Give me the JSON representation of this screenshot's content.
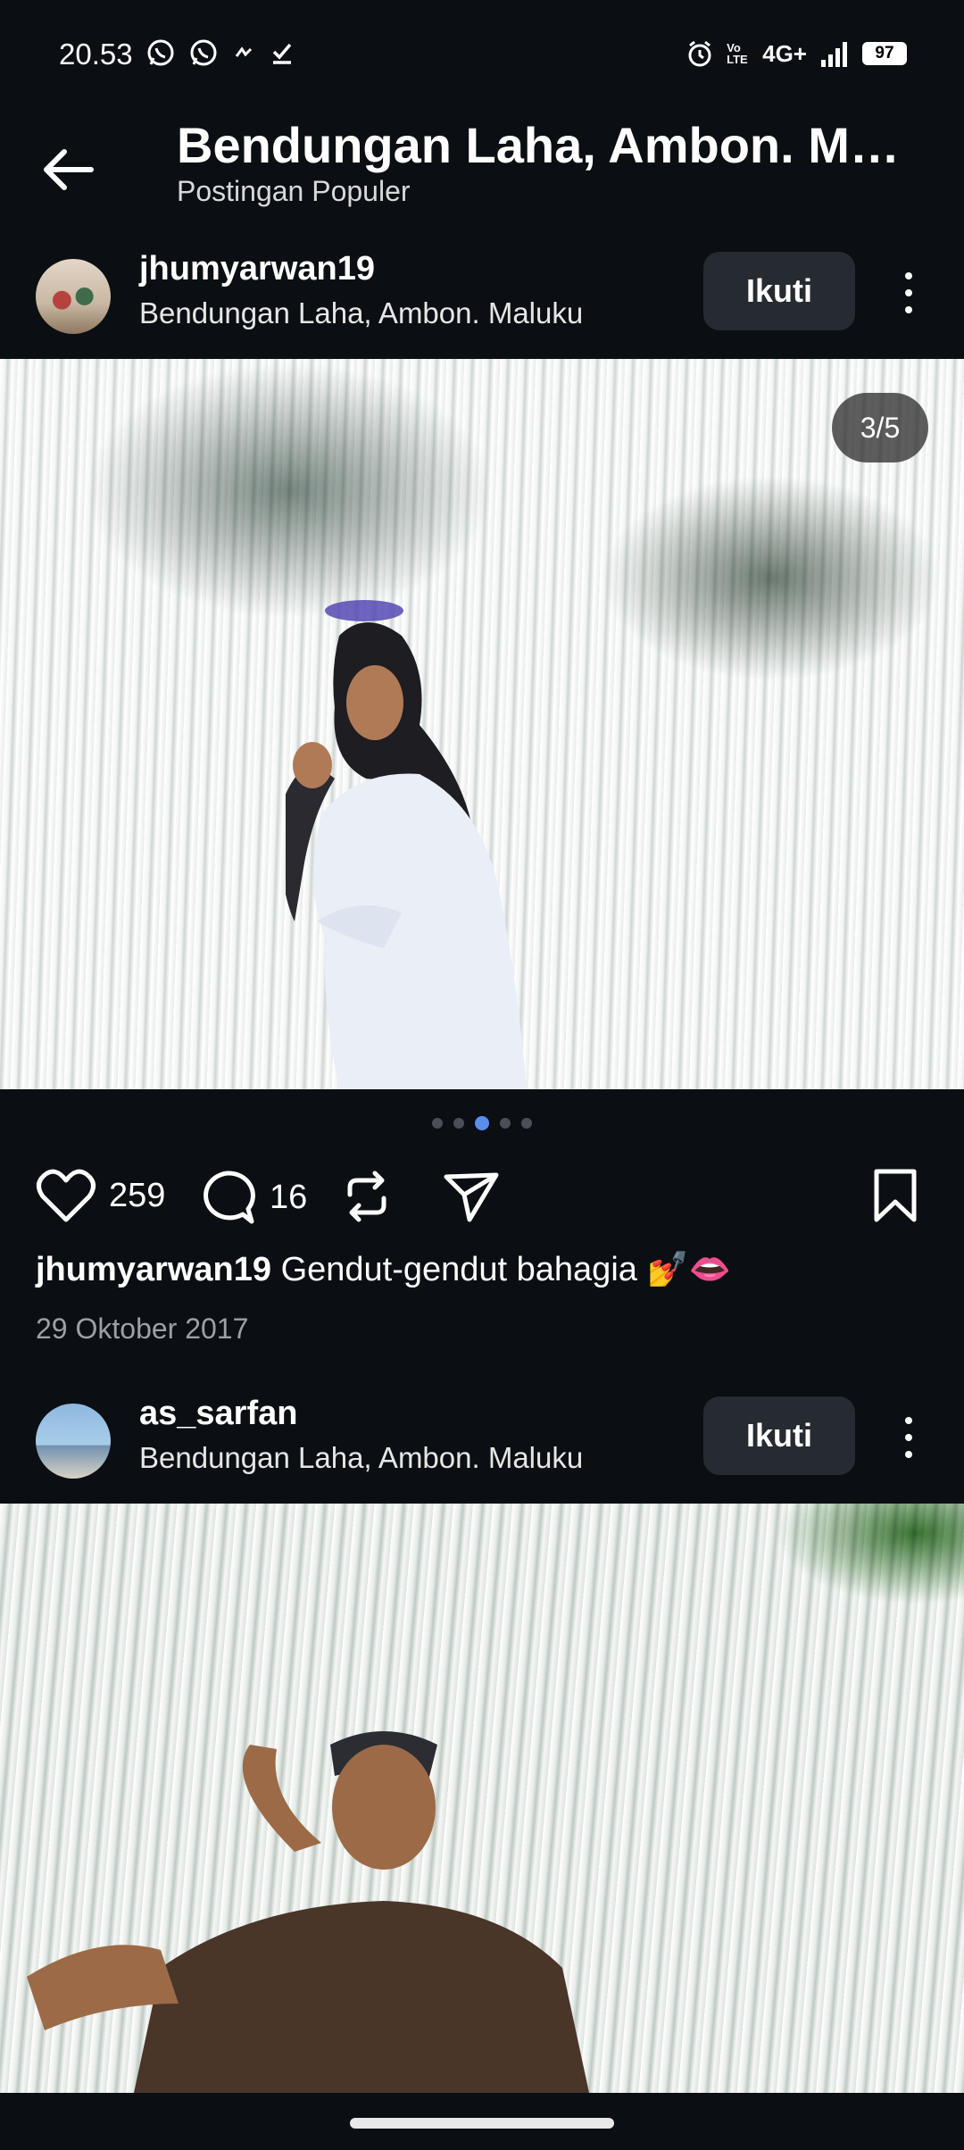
{
  "status_bar": {
    "time": "20.53",
    "network": "4G+",
    "volte": "Vo LTE",
    "battery": "97"
  },
  "header": {
    "title": "Bendungan Laha, Ambon. Mal...",
    "subtitle": "Postingan Populer"
  },
  "posts": [
    {
      "username": "jhumyarwan19",
      "location": "Bendungan Laha, Ambon. Maluku",
      "follow_label": "Ikuti",
      "page_counter": "3/5",
      "carousel": {
        "total": 5,
        "active_index": 2
      },
      "likes": "259",
      "comments": "16",
      "caption_user": "jhumyarwan19",
      "caption_text": "Gendut-gendut bahagia 💅👄",
      "date": "29 Oktober 2017"
    },
    {
      "username": "as_sarfan",
      "location": "Bendungan Laha, Ambon. Maluku",
      "follow_label": "Ikuti"
    }
  ],
  "colors": {
    "background": "#0b0f14",
    "button_bg": "#262a31",
    "active_dot": "#5b8def",
    "muted_text": "#9aa0a6"
  },
  "icons": [
    "back-arrow-icon",
    "whatsapp-icon",
    "heart-icon",
    "comment-icon",
    "repost-icon",
    "share-icon",
    "bookmark-icon",
    "more-vertical-icon"
  ]
}
